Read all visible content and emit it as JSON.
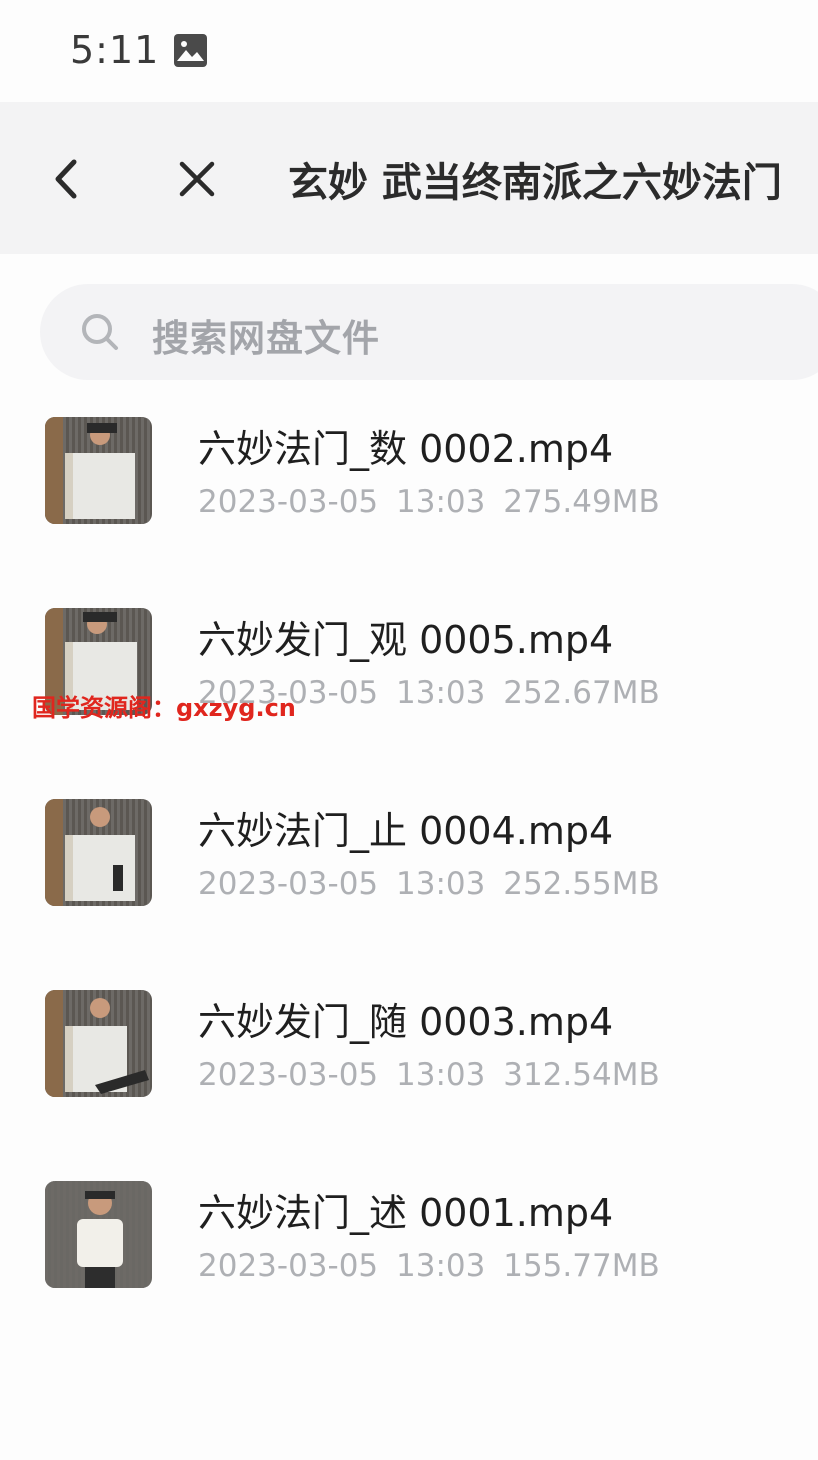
{
  "status_bar": {
    "time": "5:11",
    "icon": "image-icon"
  },
  "title_bar": {
    "back_icon": "chevron-left-icon",
    "close_icon": "close-icon",
    "title": "玄妙 武当终南派之六妙法门"
  },
  "search": {
    "icon": "search-icon",
    "placeholder": "搜索网盘文件"
  },
  "files": [
    {
      "name": "六妙法门_数 0002.mp4",
      "date": "2023-03-05",
      "time": "13:03",
      "size": "275.49MB",
      "thumb": "video-thumbnail"
    },
    {
      "name": "六妙发门_观 0005.mp4",
      "date": "2023-03-05",
      "time": "13:03",
      "size": "252.67MB",
      "thumb": "video-thumbnail"
    },
    {
      "name": "六妙法门_止 0004.mp4",
      "date": "2023-03-05",
      "time": "13:03",
      "size": "252.55MB",
      "thumb": "video-thumbnail"
    },
    {
      "name": "六妙发门_随 0003.mp4",
      "date": "2023-03-05",
      "time": "13:03",
      "size": "312.54MB",
      "thumb": "video-thumbnail"
    },
    {
      "name": "六妙法门_述 0001.mp4",
      "date": "2023-03-05",
      "time": "13:03",
      "size": "155.77MB",
      "thumb": "video-thumbnail"
    }
  ],
  "watermark": "国学资源阁：gxzyg.cn"
}
